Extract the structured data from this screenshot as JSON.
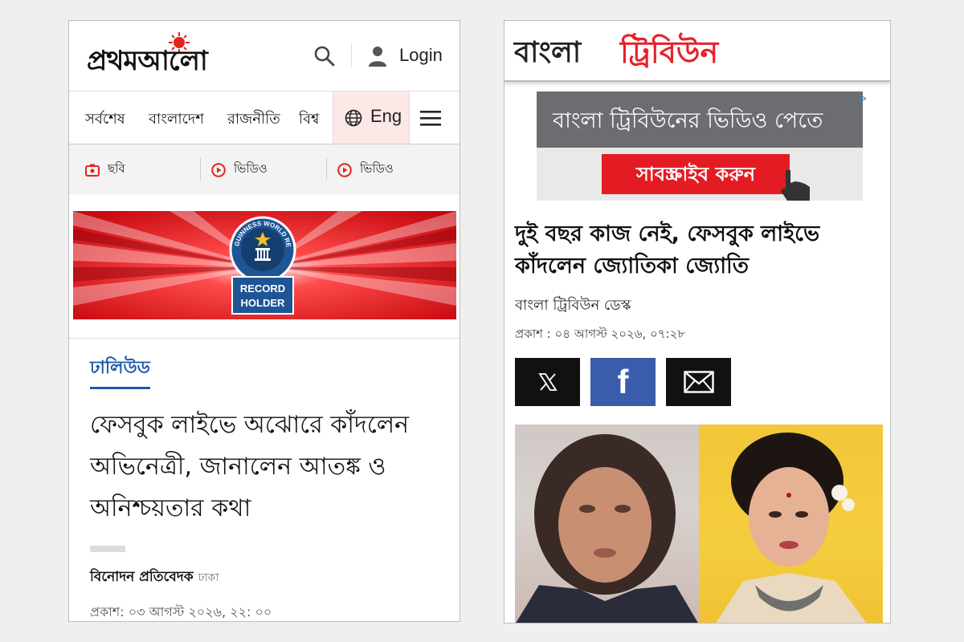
{
  "prothom_alo": {
    "logo_text": "প্রথমআলো",
    "login_label": "Login",
    "nav": [
      "সর্বশেষ",
      "বাংলাদেশ",
      "রাজনীতি",
      "বিশ্ব"
    ],
    "lang_label": "Eng",
    "sub_nav": [
      {
        "icon": "camera-icon",
        "label": "ছবি"
      },
      {
        "icon": "play-circle-icon",
        "label": "ভিডিও"
      },
      {
        "icon": "play-circle-icon",
        "label": "ভিডিও"
      }
    ],
    "banner": {
      "badge_arc_text": "GUINNESS WORLD RECORDS",
      "badge_label_1": "RECORD",
      "badge_label_2": "HOLDER"
    },
    "category": "ঢালিউড",
    "headline": "ফেসবুক লাইভে অঝোরে কাঁদলেন অভিনেত্রী, জানালেন আতঙ্ক ও অনিশ্চয়তার কথা",
    "author": "বিনোদন প্রতিবেদক",
    "location": "ঢাকা",
    "published": "প্রকাশ: ০৩ আগস্ট ২০২৬, ২২: ০০",
    "accent_color": "#e4231f",
    "category_color": "#1a5aa8"
  },
  "bangla_tribune": {
    "logo_part1": "বাংলা",
    "logo_part2": "ট্রিবিউন",
    "ad": {
      "text": "বাংলা ট্রিবিউনের ভিডিও পেতে",
      "button": "সাবস্ক্রাইব করুন",
      "adchoice": "ᐅ"
    },
    "headline": "দুই বছর কাজ নেই, ফেসবুক লাইভে কাঁদলেন জ্যোতিকা জ্যোতি",
    "desk": "বাংলা ট্রিবিউন ডেস্ক",
    "published": "প্রকাশ : ০৪ আগস্ট ২০২৬, ০৭:২৮",
    "share": [
      {
        "icon": "x-icon",
        "label": "𝕏"
      },
      {
        "icon": "facebook-icon",
        "label": "f"
      },
      {
        "icon": "mail-icon",
        "label": "✉"
      }
    ],
    "brand_color": "#e5232b"
  }
}
